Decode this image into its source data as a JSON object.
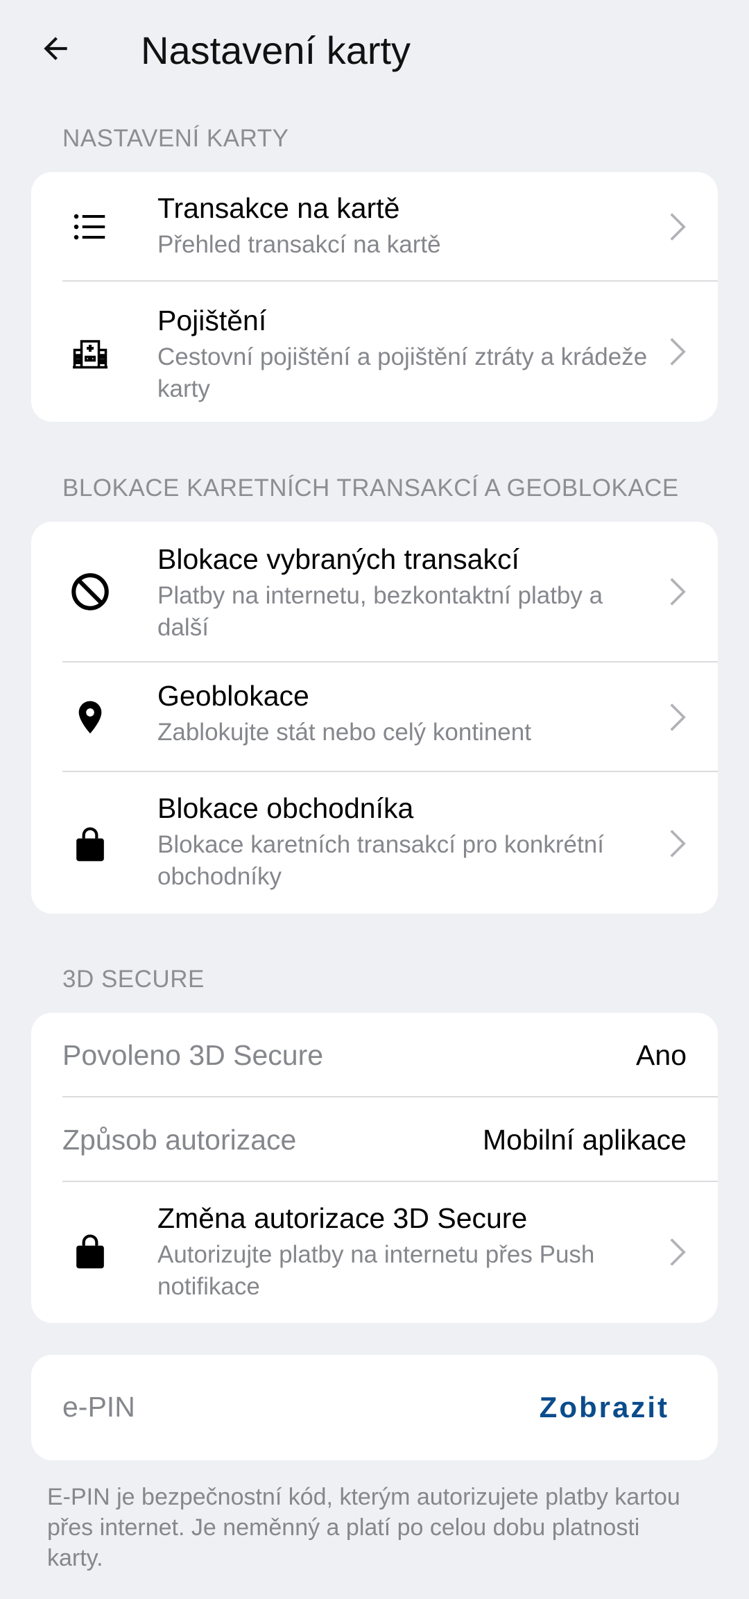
{
  "header": {
    "title": "Nastavení karty",
    "back_icon": "arrow-left-icon"
  },
  "sections": {
    "card_settings": {
      "header": "NASTAVENÍ KARTY",
      "items": [
        {
          "title": "Transakce na kartě",
          "subtitle": "Přehled transakcí na kartě",
          "icon": "list-icon"
        },
        {
          "title": "Pojištění",
          "subtitle": "Cestovní pojištění a pojištění ztráty a krádeže karty",
          "icon": "hospital-icon"
        }
      ]
    },
    "blocking": {
      "header": "BLOKACE KARETNÍCH TRANSAKCÍ A GEOBLOKACE",
      "items": [
        {
          "title": "Blokace vybraných transakcí",
          "subtitle": "Platby na internetu, bezkontaktní platby a další",
          "icon": "block-icon"
        },
        {
          "title": "Geoblokace",
          "subtitle": "Zablokujte stát nebo celý kontinent",
          "icon": "location-pin-icon"
        },
        {
          "title": "Blokace obchodníka",
          "subtitle": "Blokace karetních transakcí pro konkrétní obchodníky",
          "icon": "shopping-bag-icon"
        }
      ]
    },
    "secure3d": {
      "header": "3D SECURE",
      "enabled_label": "Povoleno 3D Secure",
      "enabled_value": "Ano",
      "auth_label": "Způsob autorizace",
      "auth_value": "Mobilní aplikace",
      "change": {
        "title": "Změna autorizace 3D Secure",
        "subtitle": "Autorizujte platby na internetu přes Push notifikace",
        "icon": "shopping-bag-icon"
      }
    },
    "epin": {
      "label": "e-PIN",
      "action": "Zobrazit",
      "note": "E-PIN je bezpečnostní kód, kterým autorizujete platby kartou přes internet. Je neměnný a platí po celou dobu platnosti karty."
    }
  },
  "colors": {
    "background": "#eff0f4",
    "card": "#ffffff",
    "accent": "#0b4c8c",
    "secondary_text": "#85878c"
  }
}
